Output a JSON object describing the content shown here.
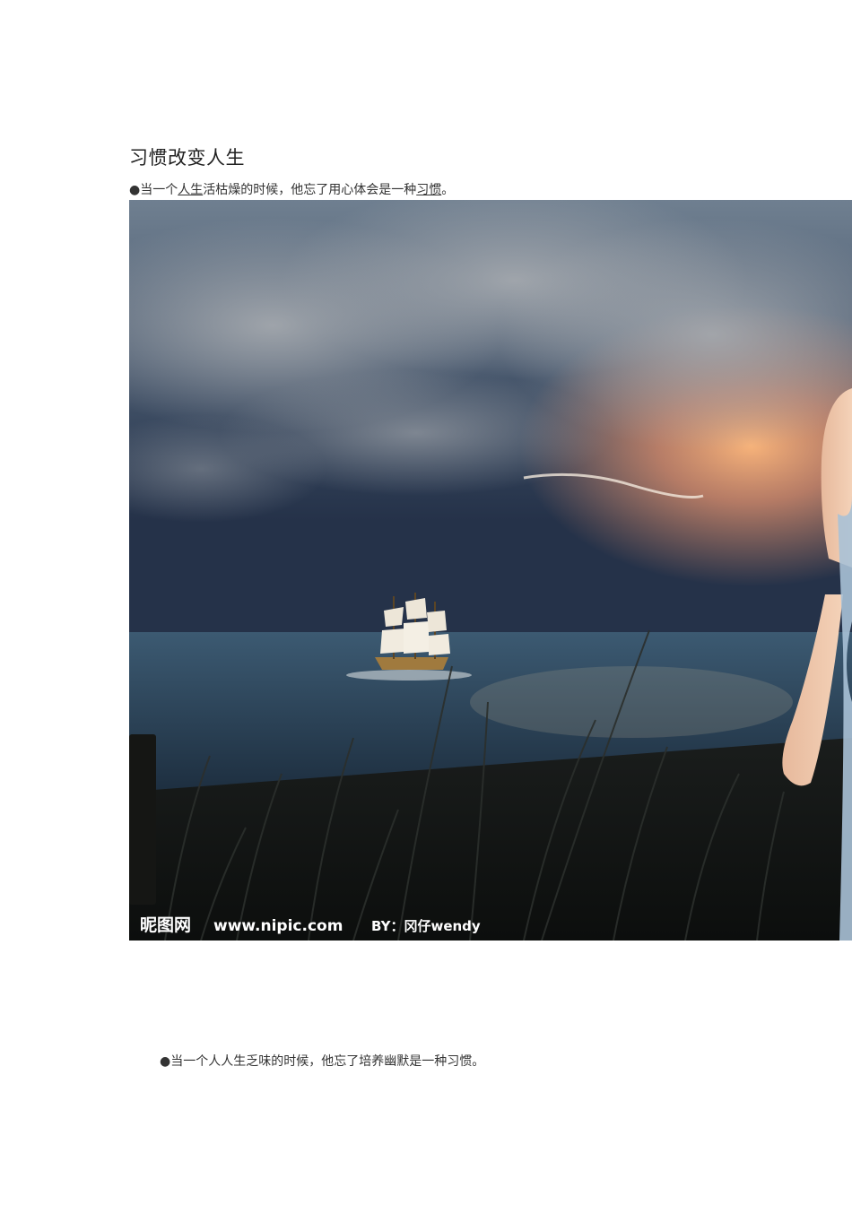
{
  "document": {
    "title": "习惯改变人生",
    "para1": {
      "bullet": "●",
      "t1": "当一个",
      "link1": "人生",
      "t2": "活枯燥的时候，他忘了用心体会是一种",
      "link2": "习惯",
      "t3": "。"
    },
    "image": {
      "watermark_logo": "昵图网",
      "watermark_url": "www.nipic.com",
      "watermark_by": "BY：冈仔wendy"
    },
    "para2": {
      "bullet": "●",
      "text": "当一个人人生乏味的时候，他忘了培养幽默是一种习惯。"
    }
  }
}
